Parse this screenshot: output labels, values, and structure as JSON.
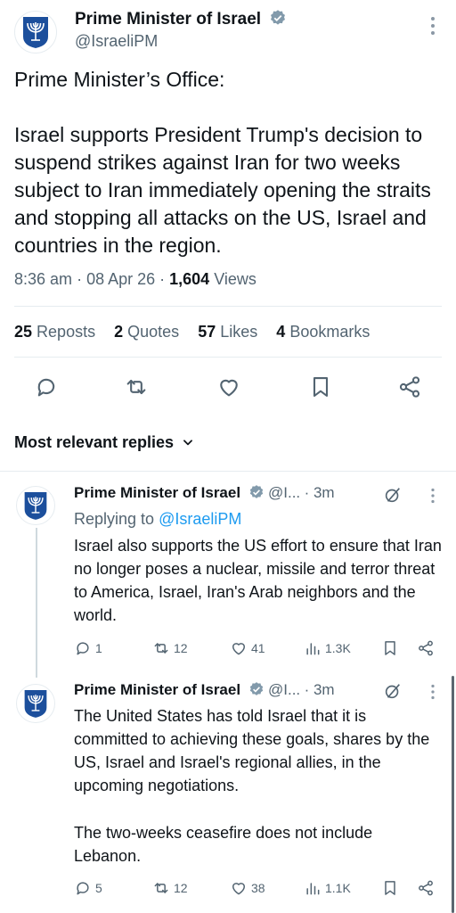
{
  "tweet": {
    "author_name": "Prime Minister of Israel",
    "author_handle": "@IsraeliPM",
    "heading": "Prime Minister’s Office:",
    "body": "Israel supports President Trump's decision to suspend strikes against Iran for two weeks subject to Iran immediately opening the straits and stopping all attacks on the US, Israel and countries in the region.",
    "time": "8:36 am",
    "date": "08 Apr 26",
    "views_count": "1,604",
    "views_label": "Views",
    "stats": {
      "reposts_count": "25",
      "reposts_label": "Reposts",
      "quotes_count": "2",
      "quotes_label": "Quotes",
      "likes_count": "57",
      "likes_label": "Likes",
      "bookmarks_count": "4",
      "bookmarks_label": "Bookmarks"
    }
  },
  "replies_header": "Most relevant replies",
  "replies": [
    {
      "author_name": "Prime Minister of Israel",
      "author_handle": "@I...",
      "age": "· 3m",
      "replying_prefix": "Replying to",
      "replying_to": "@IsraeliPM",
      "text": "Israel also supports the US effort to ensure that Iran no longer poses a nuclear, missile and terror threat to America, Israel, Iran's Arab neighbors and the world.",
      "comments": "1",
      "reposts": "12",
      "likes": "41",
      "views": "1.3K"
    },
    {
      "author_name": "Prime Minister of Israel",
      "author_handle": "@I...",
      "age": "· 3m",
      "text1": "The United States has told Israel that it is committed to achieving these goals, shares by the US, Israel and Israel's regional allies, in the upcoming negotiations.",
      "text2": "The two-weeks ceasefire does not include Lebanon.",
      "comments": "5",
      "reposts": "12",
      "likes": "38",
      "views": "1.1K"
    }
  ],
  "colors": {
    "verified": "#829aab",
    "link": "#1d9bf0",
    "secondary_text": "#536471",
    "emblem_blue": "#1c4f9c"
  },
  "icons": [
    "israel-emblem-icon",
    "verified-badge-icon",
    "more-options-icon",
    "reply-icon",
    "repost-icon",
    "like-icon",
    "bookmark-icon",
    "share-icon",
    "views-icon",
    "grok-icon",
    "chevron-down-icon"
  ]
}
